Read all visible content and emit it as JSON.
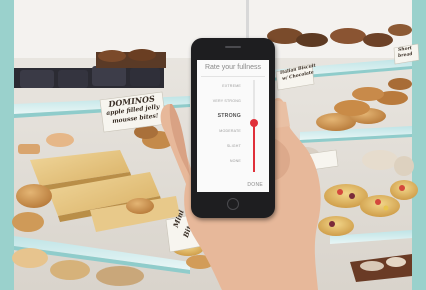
{
  "scene": {
    "labels": {
      "dominos": [
        "DOMINOS",
        "apple filled jelly",
        "mousse bites!"
      ],
      "italian_biscuit": [
        "Italian Biscuit",
        "w/ Chocolate"
      ],
      "shortbread": [
        "Short",
        "bread"
      ],
      "mini_bites": [
        "Mini",
        "Bites"
      ]
    }
  },
  "phone_app": {
    "title": "Rate your fullness",
    "levels": [
      "EXTREME",
      "VERY STRONG",
      "STRONG",
      "MODERATE",
      "SLIGHT",
      "NONE"
    ],
    "selected_level": "STRONG",
    "slider_level_fraction": 0.53,
    "done_label": "DONE",
    "accent_color": "#e0303a"
  }
}
